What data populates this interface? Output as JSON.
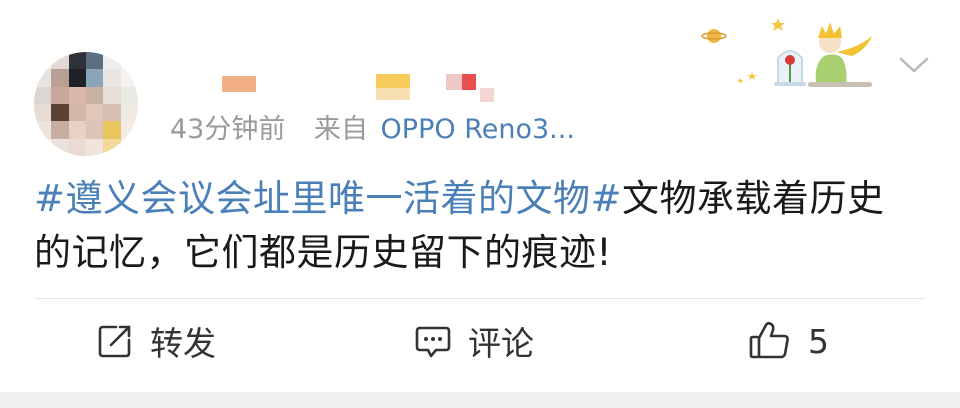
{
  "post": {
    "time": "43分钟前",
    "source_label": "来自",
    "source_device": "OPPO Reno3...",
    "topic": "#遵义会议会址里唯一活着的文物#",
    "text": "文物承载着历史的记忆，它们都是历史留下的痕迹!"
  },
  "actions": {
    "repost_label": "转发",
    "comment_label": "评论",
    "like_count": "5"
  },
  "icons": {
    "more": "chevron-down-icon",
    "repost": "repost-icon",
    "comment": "comment-icon",
    "like": "thumbs-up-icon"
  },
  "colors": {
    "link": "#4a7fb8",
    "meta": "#9a9a9a",
    "text": "#1a1a1a"
  }
}
